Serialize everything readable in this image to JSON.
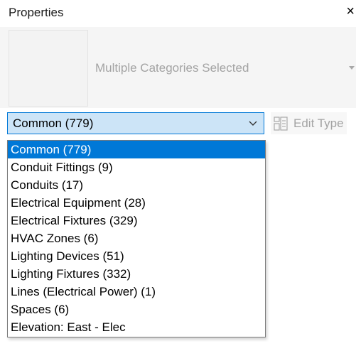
{
  "panel": {
    "title": "Properties",
    "close_glyph": "×"
  },
  "type_selector": {
    "label": "Multiple Categories Selected"
  },
  "category_filter": {
    "selected_value": "Common (779)",
    "options": [
      "Common (779)",
      "Conduit Fittings (9)",
      "Conduits (17)",
      "Electrical Equipment (28)",
      "Electrical Fixtures (329)",
      "HVAC Zones (6)",
      "Lighting Devices (51)",
      "Lighting Fixtures (332)",
      "Lines (Electrical Power) (1)",
      "Spaces (6)",
      "Elevation: East - Elec"
    ],
    "highlighted_index": 0
  },
  "edit_type": {
    "label": "Edit Type",
    "icon": "edit-type-icon",
    "enabled": false
  },
  "colors": {
    "accent": "#0078d7",
    "combo_bg": "#cce4f7",
    "disabled_text": "#a3a3a3"
  }
}
